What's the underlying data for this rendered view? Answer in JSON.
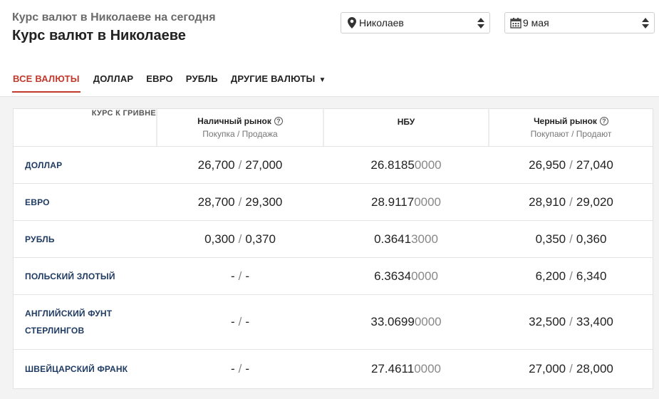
{
  "header": {
    "subtitle": "Курс валют в Николаеве на сегодня",
    "title": "Курс валют в Николаеве",
    "city_select": {
      "value": "Николаев",
      "icon": "location-pin-icon"
    },
    "date_select": {
      "value": "9 мая",
      "icon": "calendar-icon"
    }
  },
  "tabs": [
    {
      "label": "ВСЕ ВАЛЮТЫ",
      "active": true
    },
    {
      "label": "ДОЛЛАР"
    },
    {
      "label": "ЕВРО"
    },
    {
      "label": "РУБЛЬ"
    },
    {
      "label": "ДРУГИЕ ВАЛЮТЫ",
      "caret": "▼"
    }
  ],
  "table": {
    "corner_label": "КУРС К ГРИВНЕ",
    "columns": [
      {
        "name": "Наличный рынок",
        "sub": "Покупка / Продажа",
        "help": "?"
      },
      {
        "name": "НБУ",
        "sub": ""
      },
      {
        "name": "Черный рынок",
        "sub": "Покупают / Продают",
        "help": "?"
      }
    ],
    "rows": [
      {
        "currency": "ДОЛЛАР",
        "cash_buy": "26,700",
        "cash_sell": "27,000",
        "nbu_main": "26.8185",
        "nbu_tail": "0000",
        "black_buy": "26,950",
        "black_sell": "27,040"
      },
      {
        "currency": "ЕВРО",
        "cash_buy": "28,700",
        "cash_sell": "29,300",
        "nbu_main": "28.9117",
        "nbu_tail": "0000",
        "black_buy": "28,910",
        "black_sell": "29,020"
      },
      {
        "currency": "РУБЛЬ",
        "cash_buy": "0,300",
        "cash_sell": "0,370",
        "nbu_main": "0.3641",
        "nbu_tail": "3000",
        "black_buy": "0,350",
        "black_sell": "0,360"
      },
      {
        "currency": "ПОЛЬСКИЙ ЗЛОТЫЙ",
        "cash_buy": "-",
        "cash_sell": "-",
        "nbu_main": "6.3634",
        "nbu_tail": "0000",
        "black_buy": "6,200",
        "black_sell": "6,340"
      },
      {
        "currency_line1": "АНГЛИЙСКИЙ ФУНТ",
        "currency_line2": "СТЕРЛИНГОВ",
        "cash_buy": "-",
        "cash_sell": "-",
        "nbu_main": "33.0699",
        "nbu_tail": "0000",
        "black_buy": "32,500",
        "black_sell": "33,400"
      },
      {
        "currency": "ШВЕЙЦАРСКИЙ ФРАНК",
        "cash_buy": "-",
        "cash_sell": "-",
        "nbu_main": "27.4611",
        "nbu_tail": "0000",
        "black_buy": "27,000",
        "black_sell": "28,000"
      }
    ],
    "slash": "/"
  },
  "colors": {
    "accent": "#c0392b",
    "currency_text": "#1f3b63",
    "muted": "#888888"
  }
}
